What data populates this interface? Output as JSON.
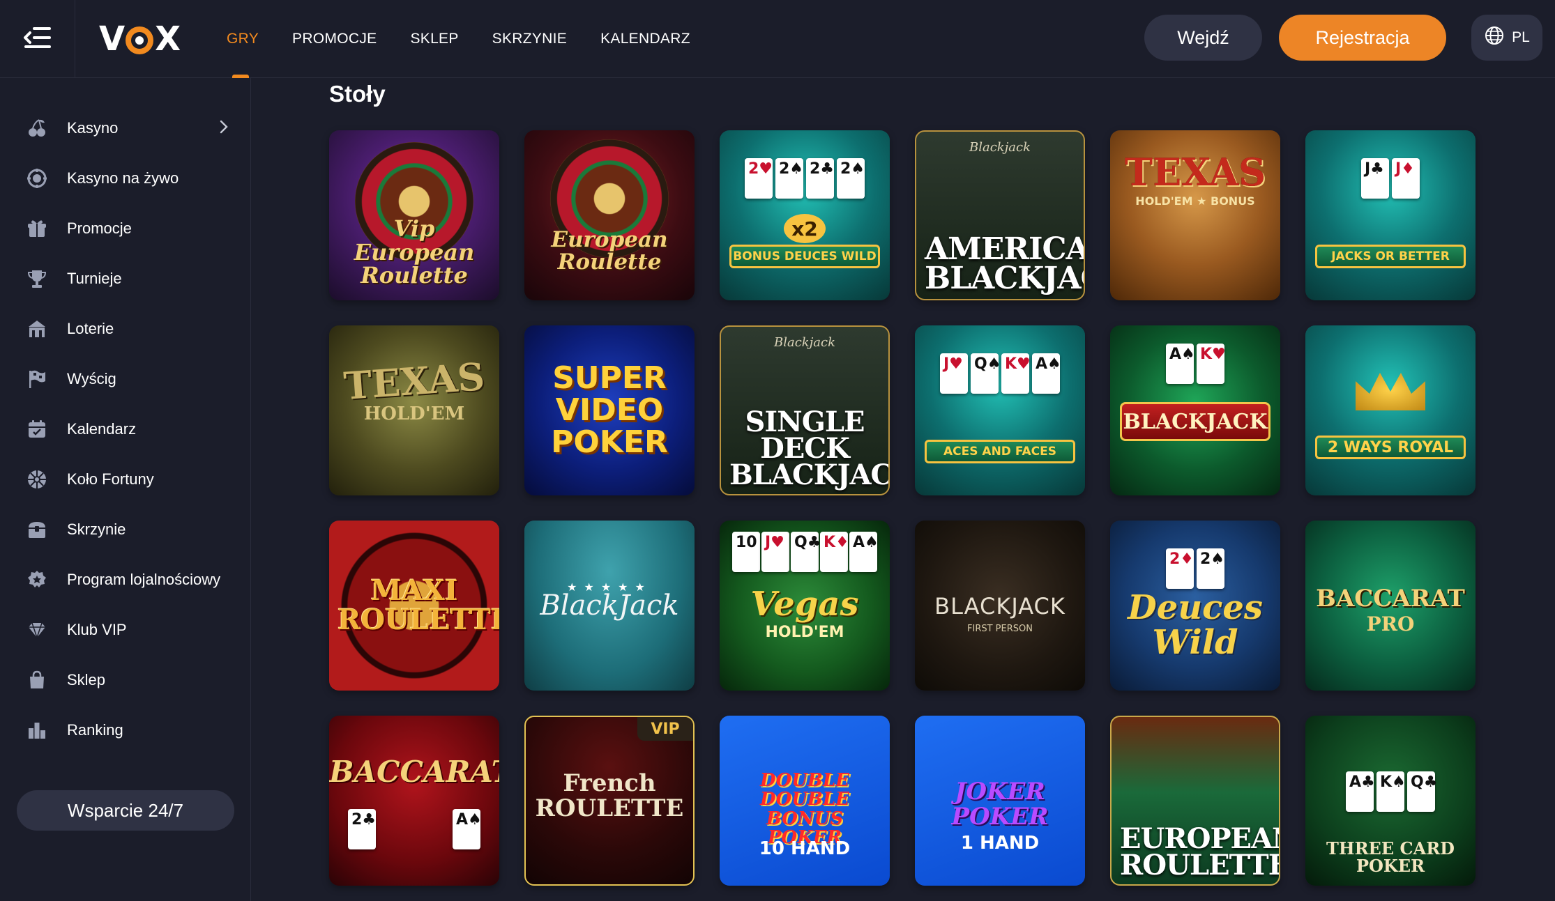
{
  "header": {
    "logo_text": "VOX",
    "nav": [
      {
        "label": "GRY",
        "active": true
      },
      {
        "label": "PROMOCJE",
        "active": false
      },
      {
        "label": "SKLEP",
        "active": false
      },
      {
        "label": "SKRZYNIE",
        "active": false
      },
      {
        "label": "KALENDARZ",
        "active": false
      }
    ],
    "login_label": "Wejdź",
    "register_label": "Rejestracja",
    "lang_label": "PL"
  },
  "sidebar": {
    "items": [
      {
        "label": "Kasyno",
        "icon": "cherries-icon"
      },
      {
        "label": "Kasyno na żywo",
        "icon": "live-chip-icon"
      },
      {
        "label": "Promocje",
        "icon": "gift-icon"
      },
      {
        "label": "Turnieje",
        "icon": "trophy-icon"
      },
      {
        "label": "Loterie",
        "icon": "lottery-icon"
      },
      {
        "label": "Wyścig",
        "icon": "race-flag-icon"
      },
      {
        "label": "Kalendarz",
        "icon": "calendar-icon"
      },
      {
        "label": "Koło Fortuny",
        "icon": "wheel-icon"
      },
      {
        "label": "Skrzynie",
        "icon": "chest-icon"
      },
      {
        "label": "Program lojalnościowy",
        "icon": "loyalty-badge-icon"
      },
      {
        "label": "Klub VIP",
        "icon": "diamond-icon"
      },
      {
        "label": "Sklep",
        "icon": "shopping-bag-icon"
      },
      {
        "label": "Ranking",
        "icon": "ranking-bars-icon"
      }
    ],
    "support_label": "Wsparcie 24/7"
  },
  "main": {
    "section_title": "Stoły",
    "games": [
      {
        "name": "Vip European Roulette"
      },
      {
        "name": "European Roulette"
      },
      {
        "name": "BONUS DEUCES WILD",
        "badge": "x2"
      },
      {
        "name": "AMERICAN BLACKJACK",
        "sub": "Blackjack"
      },
      {
        "name": "TEXAS",
        "sub": "HOLD'EM ★ BONUS"
      },
      {
        "name": "JACKS OR BETTER"
      },
      {
        "name": "TEXAS",
        "sub": "HOLD'EM"
      },
      {
        "name": "SUPER VIDEO POKER"
      },
      {
        "name": "SINGLE DECK BLACKJACK",
        "sub": "Blackjack"
      },
      {
        "name": "ACES AND FACES"
      },
      {
        "name": "BLACKJACK"
      },
      {
        "name": "2 WAYS ROYAL"
      },
      {
        "name": "MAXI ROULETTE"
      },
      {
        "name": "BlackJack"
      },
      {
        "name": "Vegas",
        "sub": "HOLD'EM"
      },
      {
        "name": "BLACKJACK",
        "sub": "FIRST PERSON"
      },
      {
        "name": "Deuces Wild"
      },
      {
        "name": "BACCARAT",
        "sub": "PRO"
      },
      {
        "name": "BACCARAT"
      },
      {
        "name": "French ROULETTE",
        "badge": "VIP"
      },
      {
        "name": "DOUBLE DOUBLE BONUS POKER",
        "sub": "10 HAND"
      },
      {
        "name": "JOKER POKER",
        "sub": "1 HAND"
      },
      {
        "name": "EUROPEAN ROULETTE"
      },
      {
        "name": "THREE CARD POKER"
      }
    ]
  },
  "colors": {
    "background": "#1b1d2a",
    "accent": "#ed8526",
    "button_dark": "#2f3244",
    "active_nav": "#f28a1f"
  }
}
